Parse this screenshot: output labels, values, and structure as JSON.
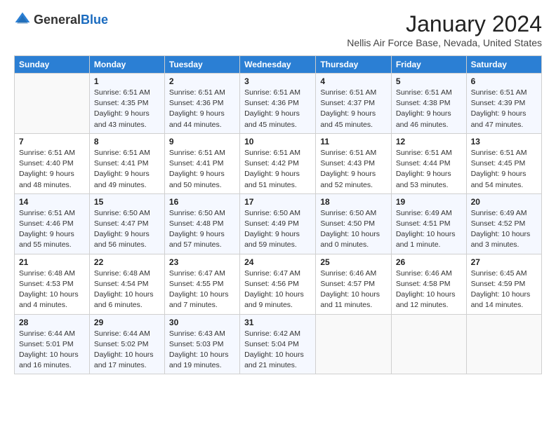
{
  "logo": {
    "general": "General",
    "blue": "Blue"
  },
  "title": "January 2024",
  "location": "Nellis Air Force Base, Nevada, United States",
  "weekdays": [
    "Sunday",
    "Monday",
    "Tuesday",
    "Wednesday",
    "Thursday",
    "Friday",
    "Saturday"
  ],
  "weeks": [
    [
      {
        "day": "",
        "info": ""
      },
      {
        "day": "1",
        "info": "Sunrise: 6:51 AM\nSunset: 4:35 PM\nDaylight: 9 hours\nand 43 minutes."
      },
      {
        "day": "2",
        "info": "Sunrise: 6:51 AM\nSunset: 4:36 PM\nDaylight: 9 hours\nand 44 minutes."
      },
      {
        "day": "3",
        "info": "Sunrise: 6:51 AM\nSunset: 4:36 PM\nDaylight: 9 hours\nand 45 minutes."
      },
      {
        "day": "4",
        "info": "Sunrise: 6:51 AM\nSunset: 4:37 PM\nDaylight: 9 hours\nand 45 minutes."
      },
      {
        "day": "5",
        "info": "Sunrise: 6:51 AM\nSunset: 4:38 PM\nDaylight: 9 hours\nand 46 minutes."
      },
      {
        "day": "6",
        "info": "Sunrise: 6:51 AM\nSunset: 4:39 PM\nDaylight: 9 hours\nand 47 minutes."
      }
    ],
    [
      {
        "day": "7",
        "info": "Sunrise: 6:51 AM\nSunset: 4:40 PM\nDaylight: 9 hours\nand 48 minutes."
      },
      {
        "day": "8",
        "info": "Sunrise: 6:51 AM\nSunset: 4:41 PM\nDaylight: 9 hours\nand 49 minutes."
      },
      {
        "day": "9",
        "info": "Sunrise: 6:51 AM\nSunset: 4:41 PM\nDaylight: 9 hours\nand 50 minutes."
      },
      {
        "day": "10",
        "info": "Sunrise: 6:51 AM\nSunset: 4:42 PM\nDaylight: 9 hours\nand 51 minutes."
      },
      {
        "day": "11",
        "info": "Sunrise: 6:51 AM\nSunset: 4:43 PM\nDaylight: 9 hours\nand 52 minutes."
      },
      {
        "day": "12",
        "info": "Sunrise: 6:51 AM\nSunset: 4:44 PM\nDaylight: 9 hours\nand 53 minutes."
      },
      {
        "day": "13",
        "info": "Sunrise: 6:51 AM\nSunset: 4:45 PM\nDaylight: 9 hours\nand 54 minutes."
      }
    ],
    [
      {
        "day": "14",
        "info": "Sunrise: 6:51 AM\nSunset: 4:46 PM\nDaylight: 9 hours\nand 55 minutes."
      },
      {
        "day": "15",
        "info": "Sunrise: 6:50 AM\nSunset: 4:47 PM\nDaylight: 9 hours\nand 56 minutes."
      },
      {
        "day": "16",
        "info": "Sunrise: 6:50 AM\nSunset: 4:48 PM\nDaylight: 9 hours\nand 57 minutes."
      },
      {
        "day": "17",
        "info": "Sunrise: 6:50 AM\nSunset: 4:49 PM\nDaylight: 9 hours\nand 59 minutes."
      },
      {
        "day": "18",
        "info": "Sunrise: 6:50 AM\nSunset: 4:50 PM\nDaylight: 10 hours\nand 0 minutes."
      },
      {
        "day": "19",
        "info": "Sunrise: 6:49 AM\nSunset: 4:51 PM\nDaylight: 10 hours\nand 1 minute."
      },
      {
        "day": "20",
        "info": "Sunrise: 6:49 AM\nSunset: 4:52 PM\nDaylight: 10 hours\nand 3 minutes."
      }
    ],
    [
      {
        "day": "21",
        "info": "Sunrise: 6:48 AM\nSunset: 4:53 PM\nDaylight: 10 hours\nand 4 minutes."
      },
      {
        "day": "22",
        "info": "Sunrise: 6:48 AM\nSunset: 4:54 PM\nDaylight: 10 hours\nand 6 minutes."
      },
      {
        "day": "23",
        "info": "Sunrise: 6:47 AM\nSunset: 4:55 PM\nDaylight: 10 hours\nand 7 minutes."
      },
      {
        "day": "24",
        "info": "Sunrise: 6:47 AM\nSunset: 4:56 PM\nDaylight: 10 hours\nand 9 minutes."
      },
      {
        "day": "25",
        "info": "Sunrise: 6:46 AM\nSunset: 4:57 PM\nDaylight: 10 hours\nand 11 minutes."
      },
      {
        "day": "26",
        "info": "Sunrise: 6:46 AM\nSunset: 4:58 PM\nDaylight: 10 hours\nand 12 minutes."
      },
      {
        "day": "27",
        "info": "Sunrise: 6:45 AM\nSunset: 4:59 PM\nDaylight: 10 hours\nand 14 minutes."
      }
    ],
    [
      {
        "day": "28",
        "info": "Sunrise: 6:44 AM\nSunset: 5:01 PM\nDaylight: 10 hours\nand 16 minutes."
      },
      {
        "day": "29",
        "info": "Sunrise: 6:44 AM\nSunset: 5:02 PM\nDaylight: 10 hours\nand 17 minutes."
      },
      {
        "day": "30",
        "info": "Sunrise: 6:43 AM\nSunset: 5:03 PM\nDaylight: 10 hours\nand 19 minutes."
      },
      {
        "day": "31",
        "info": "Sunrise: 6:42 AM\nSunset: 5:04 PM\nDaylight: 10 hours\nand 21 minutes."
      },
      {
        "day": "",
        "info": ""
      },
      {
        "day": "",
        "info": ""
      },
      {
        "day": "",
        "info": ""
      }
    ]
  ]
}
